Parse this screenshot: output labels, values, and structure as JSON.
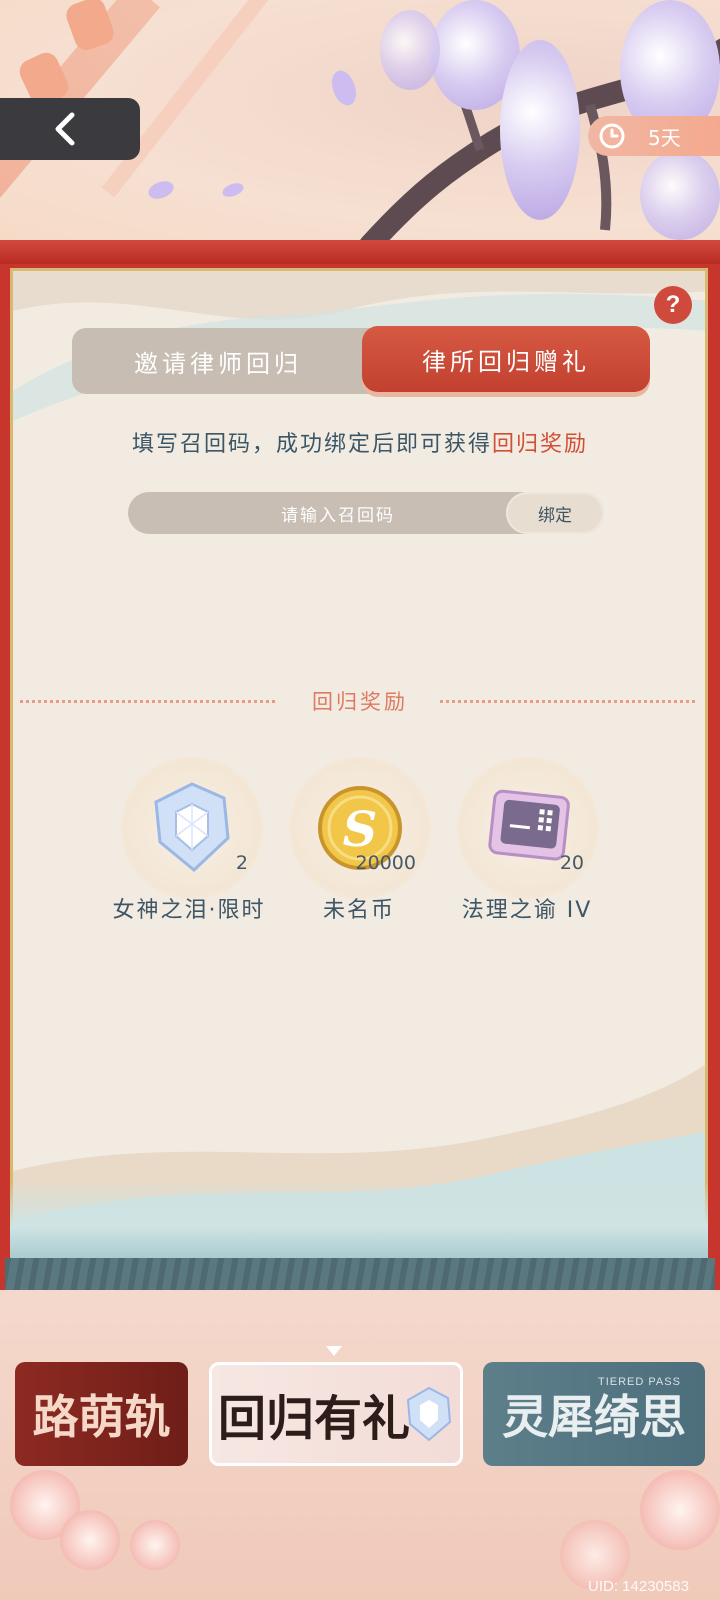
{
  "header": {
    "back_label": "",
    "timer_text": "5天"
  },
  "tabs": [
    {
      "label": "邀请律师回归",
      "active": false
    },
    {
      "label": "律所回归赠礼",
      "active": true
    }
  ],
  "hint": {
    "prefix": "填写召回码，成功绑定后即可获得",
    "highlight": "回归奖励"
  },
  "code": {
    "placeholder": "请输入召回码",
    "bind_label": "绑定"
  },
  "rewards_section": {
    "title": "回归奖励",
    "items": [
      {
        "name": "女神之泪·限时",
        "count": "2",
        "icon": "gem-icon"
      },
      {
        "name": "未名币",
        "count": "20000",
        "icon": "coin-icon"
      },
      {
        "name": "法理之谕 IV",
        "count": "20",
        "icon": "card-chip-icon"
      }
    ]
  },
  "banners": [
    {
      "title": "路萌轨"
    },
    {
      "title": "回归有礼"
    },
    {
      "title": "灵犀绮思",
      "subtitle": "TIERED PASS"
    }
  ],
  "footer": {
    "uid": "UID: 14230583"
  },
  "colors": {
    "accent_red": "#c7352d",
    "tab_active": "#d65a44",
    "highlight_text": "#d24e37",
    "body_text": "#3c5665"
  }
}
